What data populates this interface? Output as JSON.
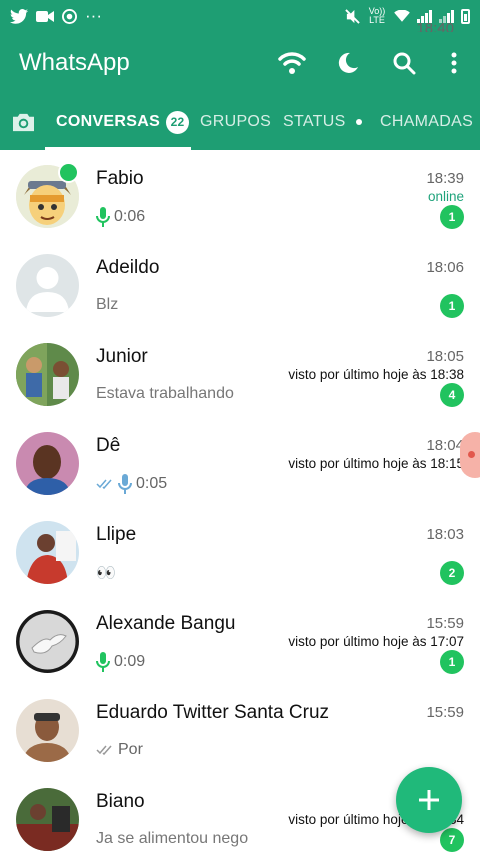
{
  "status_bar": {
    "time": "18:40",
    "network_label": "Vo)) LTE"
  },
  "app": {
    "title": "WhatsApp",
    "accent": "#1e9e73",
    "unread_badge_color": "#21c35f"
  },
  "tabs": [
    {
      "label": "CONVERSAS",
      "badge": "22",
      "active": true
    },
    {
      "label": "GRUPOS"
    },
    {
      "label": "STATUS",
      "has_dot": true
    },
    {
      "label": "CHAMADAS"
    }
  ],
  "chats": [
    {
      "name": "Fabio",
      "time": "18:39",
      "status": "online",
      "preview": "0:06",
      "preview_type": "voice",
      "unread": "1"
    },
    {
      "name": "Adeildo",
      "time": "18:06",
      "status": "",
      "preview": "Blz",
      "preview_type": "text",
      "unread": "1"
    },
    {
      "name": "Junior",
      "time": "18:05",
      "status": "visto por último hoje às 18:38",
      "preview": "Estava trabalhando",
      "preview_type": "text",
      "unread": "4"
    },
    {
      "name": "Dê",
      "time": "18:04",
      "status": "visto por último hoje às 18:15",
      "preview": "0:05",
      "preview_type": "voice_sent",
      "unread": ""
    },
    {
      "name": "Llipe",
      "time": "18:03",
      "status": "",
      "preview": "👀",
      "preview_type": "text",
      "unread": "2"
    },
    {
      "name": "Alexande Bangu",
      "time": "15:59",
      "status": "visto por último hoje às 17:07",
      "preview": "0:09",
      "preview_type": "voice",
      "unread": "1"
    },
    {
      "name": "Eduardo Twitter Santa Cruz",
      "time": "15:59",
      "status": "",
      "preview": "Por",
      "preview_type": "sent",
      "unread": ""
    },
    {
      "name": "Biano",
      "time": "",
      "status": "visto por último hoje às 18:34",
      "preview": "Ja se alimentou nego",
      "preview_type": "text",
      "unread": "7"
    }
  ],
  "fab": {
    "icon": "plus-icon"
  }
}
